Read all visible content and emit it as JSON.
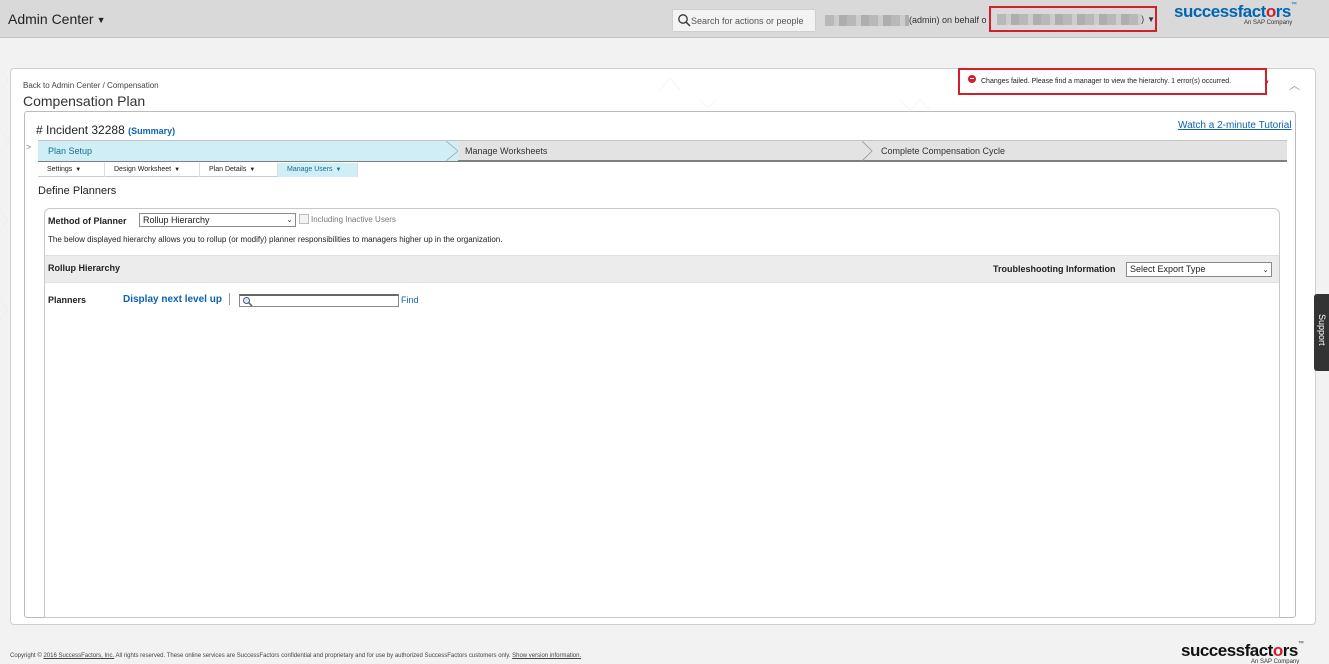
{
  "topbar": {
    "admin_menu": "Admin Center",
    "search_placeholder": "Search for actions or people",
    "proxy_mid": "(admin) on behalf o",
    "proxy_end": ")"
  },
  "brand": {
    "part1": "successfact",
    "heart_letter": "o",
    "part2": "rs",
    "tm": "™",
    "sub": "An SAP Company"
  },
  "breadcrumb": {
    "back": "Back to Admin Center",
    "sep": " / ",
    "current": "Compensation"
  },
  "page_title": "Compensation Plan",
  "error_message": "Changes failed. Please find a manager to view the hierarchy. 1 error(s) occurred.",
  "incident": {
    "title": "# Incident 32288",
    "summary": "(Summary)"
  },
  "tutorial_link": "Watch a 2-minute Tutorial",
  "steps": [
    {
      "label": "Plan Setup",
      "active": true
    },
    {
      "label": "Manage Worksheets",
      "active": false
    },
    {
      "label": "Complete Compensation Cycle",
      "active": false
    }
  ],
  "subtabs": [
    {
      "label": "Settings",
      "active": false
    },
    {
      "label": "Design Worksheet",
      "active": false
    },
    {
      "label": "Plan Details",
      "active": false
    },
    {
      "label": "Manage Users",
      "active": true
    }
  ],
  "section_title": "Define Planners",
  "method": {
    "label": "Method of Planner",
    "selected": "Rollup Hierarchy",
    "checkbox_label": "Including Inactive Users",
    "checkbox_checked": false,
    "description": "The below displayed hierarchy allows you to rollup (or modify) planner responsibilities to managers higher up in the organization."
  },
  "rollup": {
    "title": "Rollup Hierarchy",
    "troubleshooting_label": "Troubleshooting Information",
    "export_selected": "Select Export Type"
  },
  "planners": {
    "label": "Planners",
    "next_level": "Display next level up",
    "search_value": "",
    "find": "Find"
  },
  "support_tab": "Support",
  "footer": {
    "prefix": "Copyright © ",
    "company_link": "2016 SuccessFactors, Inc.",
    "text": " All rights reserved. These online services are SuccessFactors confidential and proprietary and for use by authorized SuccessFactors customers only. ",
    "version_link": "Show version information."
  },
  "colors": {
    "brand_blue": "#0066b3",
    "brand_red": "#d1202a",
    "link_blue": "#0b63b0",
    "active_tab": "#cfeef6"
  }
}
